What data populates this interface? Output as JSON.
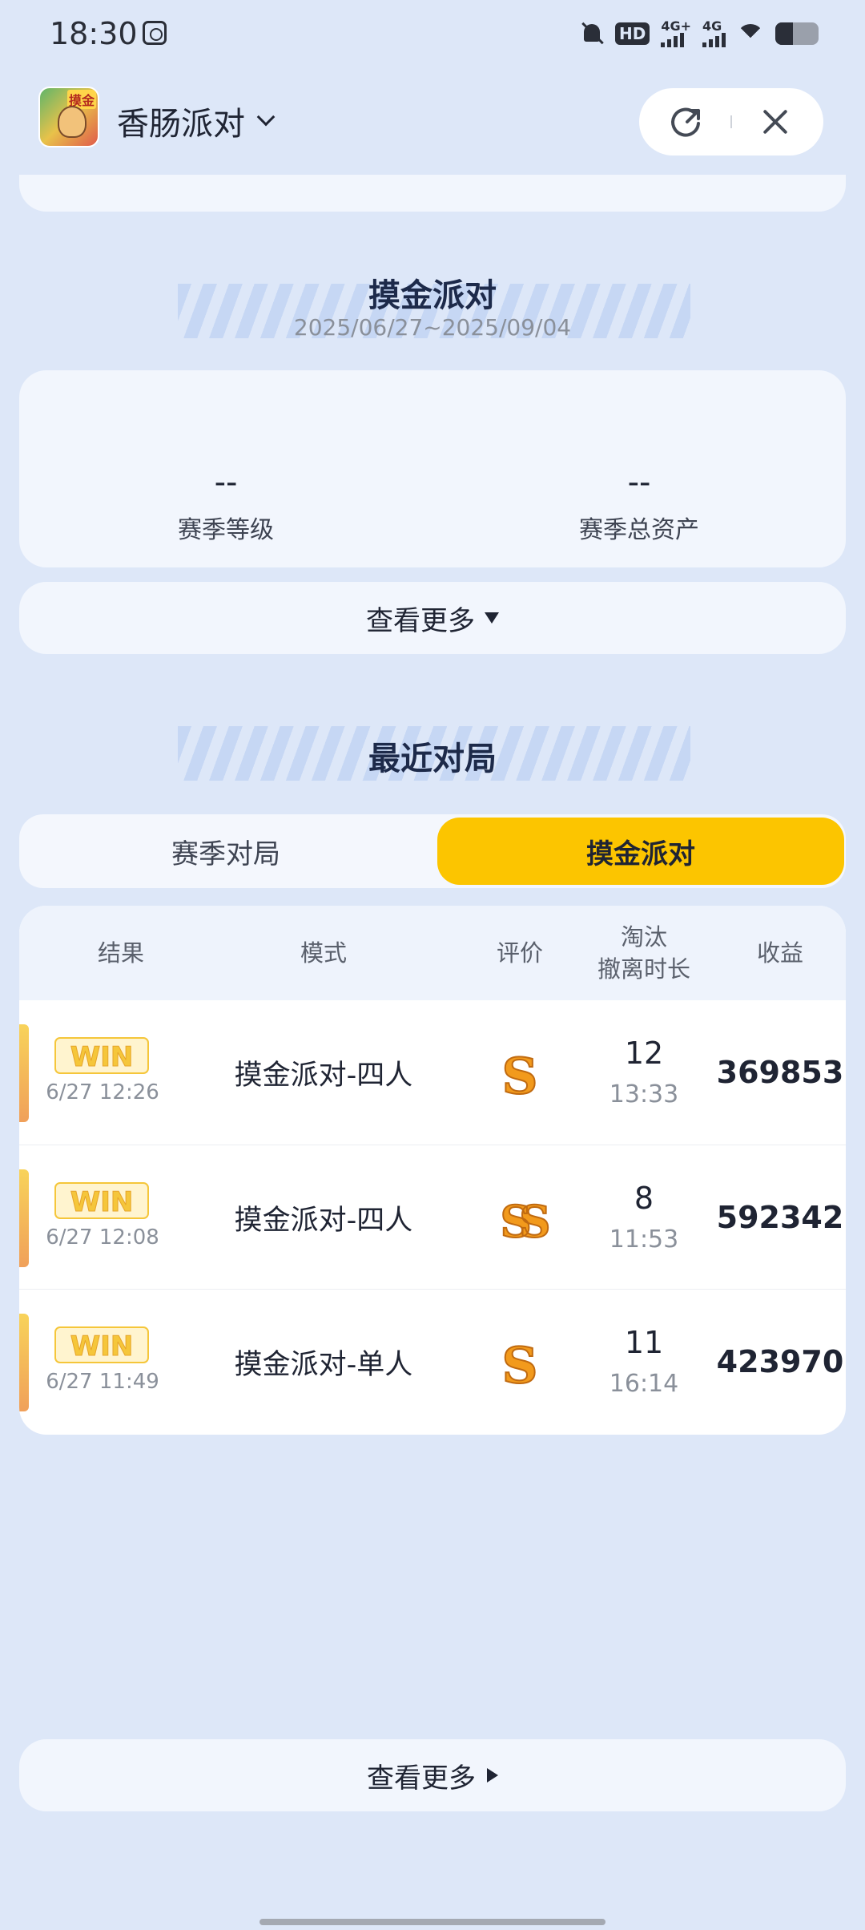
{
  "status_bar": {
    "time": "18:30",
    "icons": [
      "screenshot-icon",
      "bell-off-icon",
      "hd-icon",
      "signal-icon",
      "signal-icon",
      "wifi-icon",
      "battery-icon"
    ],
    "hd_label": "HD",
    "signal_1_label": "4G+",
    "signal_2_label": "4G",
    "battery_level": 0.4
  },
  "header": {
    "app_name": "香肠派对",
    "app_icon_badge": "摸金",
    "icons": [
      "chevron-down-icon",
      "share-icon",
      "close-icon"
    ]
  },
  "season": {
    "title": "摸金派对",
    "date_range": "2025/06/27~2025/09/04",
    "stats": [
      {
        "value": "--",
        "label": "赛季等级"
      },
      {
        "value": "--",
        "label": "赛季总资产"
      }
    ],
    "more_label": "查看更多"
  },
  "recent": {
    "title": "最近对局",
    "tabs": [
      {
        "label": "赛季对局",
        "active": false
      },
      {
        "label": "摸金派对",
        "active": true
      }
    ],
    "columns": {
      "result": "结果",
      "mode": "模式",
      "rating": "评价",
      "elim_line1": "淘汰",
      "elim_line2": "撤离时长",
      "earnings": "收益"
    },
    "rows": [
      {
        "result": "WIN",
        "time": "6/27 12:26",
        "mode": "摸金派对-四人",
        "rating": "S",
        "eliminations": "12",
        "duration": "13:33",
        "earnings": "369853"
      },
      {
        "result": "WIN",
        "time": "6/27 12:08",
        "mode": "摸金派对-四人",
        "rating": "SS",
        "eliminations": "8",
        "duration": "11:53",
        "earnings": "592342"
      },
      {
        "result": "WIN",
        "time": "6/27 11:49",
        "mode": "摸金派对-单人",
        "rating": "S",
        "eliminations": "11",
        "duration": "16:14",
        "earnings": "423970"
      }
    ],
    "more_label": "查看更多"
  },
  "colors": {
    "background": "#dde7f8",
    "card": "#f2f6fd",
    "active_tab": "#fcc500",
    "win_gold": "#f5c63a",
    "rating_orange": "#f29a1c"
  }
}
